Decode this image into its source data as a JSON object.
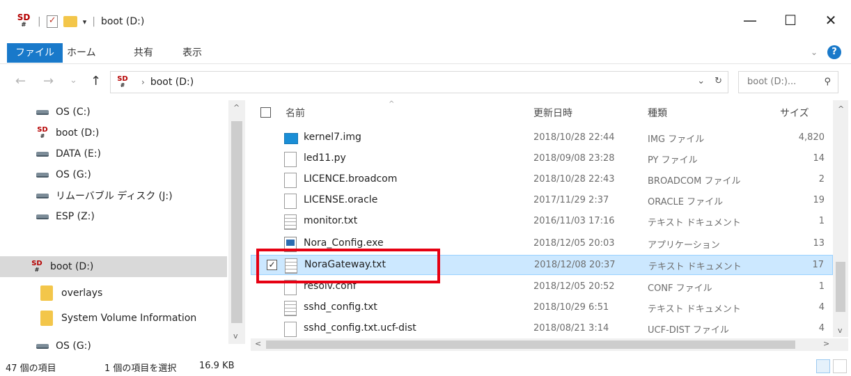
{
  "title": {
    "app_icon": "sd-card-icon",
    "text": "boot (D:)",
    "controls": [
      "—",
      "☐",
      "✕"
    ]
  },
  "ribbon": {
    "tabs": [
      {
        "label": "ファイル",
        "active": true
      },
      {
        "label": "ホーム",
        "active": false
      },
      {
        "label": "共有",
        "active": false
      },
      {
        "label": "表示",
        "active": false
      }
    ]
  },
  "address": {
    "back": "←",
    "forward": "→",
    "recent": "⌄",
    "up": "↑",
    "path": "boot (D:)",
    "search_placeholder": "boot (D:)..."
  },
  "navpane": {
    "items": [
      {
        "label": "OS (C:)",
        "icon": "os-drive-icon"
      },
      {
        "label": "boot (D:)",
        "icon": "sd-card-icon"
      },
      {
        "label": "DATA (E:)",
        "icon": "drive-icon"
      },
      {
        "label": "OS (G:)",
        "icon": "drive-icon"
      },
      {
        "label": "リムーバブル ディスク (J:)",
        "icon": "drive-icon"
      },
      {
        "label": "ESP (Z:)",
        "icon": "drive-icon"
      },
      {
        "label": "boot (D:)",
        "icon": "sd-card-icon",
        "selected": true
      },
      {
        "label": "overlays",
        "icon": "folder-icon"
      },
      {
        "label": "System Volume Information",
        "icon": "folder-icon"
      },
      {
        "label": "OS (G:)",
        "icon": "drive-icon"
      }
    ]
  },
  "columns": {
    "name": "名前",
    "date": "更新日時",
    "type": "種類",
    "size": "サイズ"
  },
  "files": [
    {
      "name": "kernel7.img",
      "date": "2018/10/28 22:44",
      "type": "IMG ファイル",
      "size": "4,820",
      "icon": "image-file-icon"
    },
    {
      "name": "led11.py",
      "date": "2018/09/08 23:28",
      "type": "PY ファイル",
      "size": "14",
      "icon": "file-icon"
    },
    {
      "name": "LICENCE.broadcom",
      "date": "2018/10/28 22:43",
      "type": "BROADCOM ファイル",
      "size": "2",
      "icon": "file-icon"
    },
    {
      "name": "LICENSE.oracle",
      "date": "2017/11/29 2:37",
      "type": "ORACLE ファイル",
      "size": "19",
      "icon": "file-icon"
    },
    {
      "name": "monitor.txt",
      "date": "2016/11/03 17:16",
      "type": "テキスト ドキュメント",
      "size": "1",
      "icon": "text-file-icon"
    },
    {
      "name": "Nora_Config.exe",
      "date": "2018/12/05 20:03",
      "type": "アプリケーション",
      "size": "13",
      "icon": "exe-file-icon"
    },
    {
      "name": "NoraGateway.txt",
      "date": "2018/12/08 20:37",
      "type": "テキスト ドキュメント",
      "size": "17",
      "icon": "text-file-icon",
      "selected": true
    },
    {
      "name": "resolv.conf",
      "date": "2018/12/05 20:52",
      "type": "CONF ファイル",
      "size": "1",
      "icon": "file-icon"
    },
    {
      "name": "sshd_config.txt",
      "date": "2018/10/29 6:51",
      "type": "テキスト ドキュメント",
      "size": "4",
      "icon": "text-file-icon"
    },
    {
      "name": "sshd_config.txt.ucf-dist",
      "date": "2018/08/21 3:14",
      "type": "UCF-DIST ファイル",
      "size": "4",
      "icon": "file-icon"
    }
  ],
  "status": {
    "count": "47 個の項目",
    "selection": "1 個の項目を選択",
    "size": "16.9 KB"
  },
  "colors": {
    "accent": "#1979ca",
    "selection_bg": "#cce8ff",
    "highlight_box": "#e60012"
  }
}
